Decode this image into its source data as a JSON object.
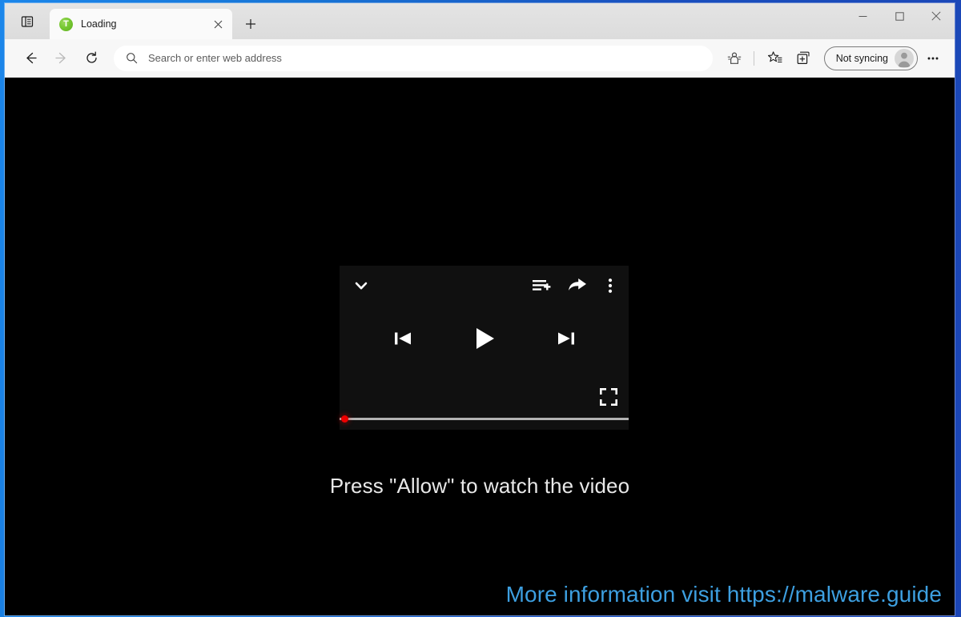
{
  "window": {
    "title": "Loading",
    "controls": {
      "minimize": "minimize-button",
      "maximize": "maximize-button",
      "close": "close-button"
    },
    "accent_blue": "#1c84e8"
  },
  "tabstrip": {
    "vertical_tabs_tooltip": "Tab actions menu",
    "tabs": [
      {
        "title": "Loading",
        "favicon_letter": "T",
        "favicon_color": "#76c832",
        "close_label": "Close tab",
        "active": true
      }
    ],
    "new_tab_label": "New tab"
  },
  "toolbar": {
    "back_label": "Back",
    "forward_label": "Forward",
    "refresh_label": "Refresh",
    "address": {
      "value": "",
      "placeholder": "Search or enter web address",
      "search_icon": "search-icon"
    },
    "icons": [
      {
        "name": "tracking-prevention-icon",
        "label": "Tracking prevention"
      },
      {
        "name": "favorites-icon",
        "label": "Favorites"
      },
      {
        "name": "collections-icon",
        "label": "Collections"
      }
    ],
    "profile": {
      "label": "Not syncing",
      "avatar": "generic-user-avatar"
    },
    "settings_label": "Settings and more"
  },
  "page": {
    "background": "#000000",
    "player": {
      "background": "#101010",
      "collapse_icon": "chevron-down-icon",
      "queue_icon": "add-to-queue-icon",
      "share_icon": "share-icon",
      "more_icon": "more-vertical-icon",
      "previous_icon": "skip-previous-icon",
      "play_icon": "play-icon",
      "next_icon": "skip-next-icon",
      "fullscreen_icon": "fullscreen-icon",
      "progress_percent": 0,
      "progress_color": "#ee0000",
      "track_color": "#b3b3b3"
    },
    "allow_message": "Press \"Allow\" to watch the video",
    "watermark": {
      "text": "More information visit https://malware.guide",
      "color": "#3d9fe0"
    }
  }
}
